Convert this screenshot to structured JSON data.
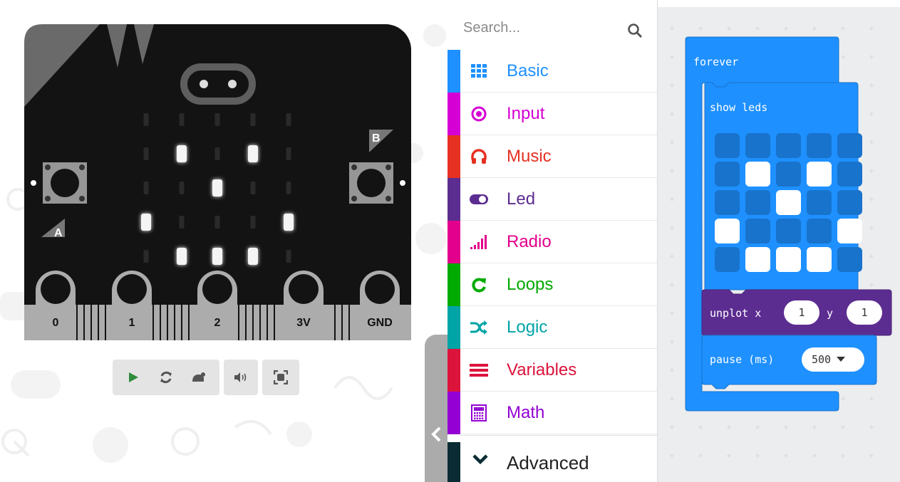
{
  "simulator": {
    "buttons": {
      "a": "A",
      "b": "B"
    },
    "pins": [
      "0",
      "1",
      "2",
      "3V",
      "GND"
    ],
    "leds_on": [
      [
        1,
        1
      ],
      [
        1,
        3
      ],
      [
        2,
        2
      ],
      [
        3,
        0
      ],
      [
        3,
        4
      ],
      [
        4,
        1
      ],
      [
        4,
        2
      ],
      [
        4,
        3
      ]
    ]
  },
  "sim_toolbar": {
    "icons": [
      "play-icon",
      "restart-icon",
      "slow-motion-icon",
      "sound-icon",
      "fullscreen-icon"
    ]
  },
  "toolbox": {
    "search_placeholder": "Search...",
    "categories": [
      {
        "label": "Basic",
        "color": "#1e90ff",
        "icon": "grid-icon"
      },
      {
        "label": "Input",
        "color": "#d400d4",
        "icon": "target-icon"
      },
      {
        "label": "Music",
        "color": "#e63022",
        "icon": "headphones-icon"
      },
      {
        "label": "Led",
        "color": "#5c2d91",
        "icon": "toggle-icon"
      },
      {
        "label": "Radio",
        "color": "#e3008c",
        "icon": "signal-bars-icon"
      },
      {
        "label": "Loops",
        "color": "#00aa00",
        "icon": "loop-icon"
      },
      {
        "label": "Logic",
        "color": "#00a4a6",
        "icon": "shuffle-icon"
      },
      {
        "label": "Variables",
        "color": "#dc143c",
        "icon": "lines-icon"
      },
      {
        "label": "Math",
        "color": "#9400d3",
        "icon": "calculator-icon"
      }
    ],
    "advanced_label": "Advanced"
  },
  "workspace": {
    "forever_label": "forever",
    "show_leds_label": "show leds",
    "led_grid": [
      [
        0,
        0,
        0,
        0,
        0
      ],
      [
        0,
        1,
        0,
        1,
        0
      ],
      [
        0,
        0,
        1,
        0,
        0
      ],
      [
        1,
        0,
        0,
        0,
        1
      ],
      [
        0,
        1,
        1,
        1,
        0
      ]
    ],
    "unplot": {
      "label": "unplot x",
      "y_label": "y",
      "x": "1",
      "y": "1"
    },
    "pause": {
      "label": "pause (ms)",
      "value": "500"
    },
    "colors": {
      "basic": "#1e90ff",
      "basic_dark": "#1873cc",
      "led": "#5c2d91",
      "led_dark": "#4a2474"
    }
  }
}
